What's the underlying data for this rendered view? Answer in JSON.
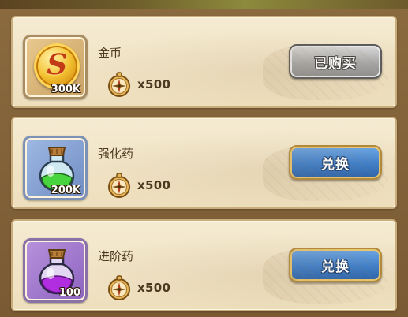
{
  "shop": {
    "currency_icon": "compass-icon",
    "items": [
      {
        "name": "金币",
        "icon": "gold-coin-icon",
        "frame_color": "#d8b577",
        "quantity": "300K",
        "cost": "x500",
        "button_label": "已购买",
        "button_state": "disabled"
      },
      {
        "name": "强化药",
        "icon": "green-potion-icon",
        "frame_color": "#8fa9d8",
        "quantity": "200K",
        "cost": "x500",
        "button_label": "兑换",
        "button_state": "active"
      },
      {
        "name": "进阶药",
        "icon": "purple-potion-icon",
        "frame_color": "#a57fd0",
        "quantity": "100",
        "cost": "x500",
        "button_label": "兑换",
        "button_state": "active"
      }
    ]
  }
}
